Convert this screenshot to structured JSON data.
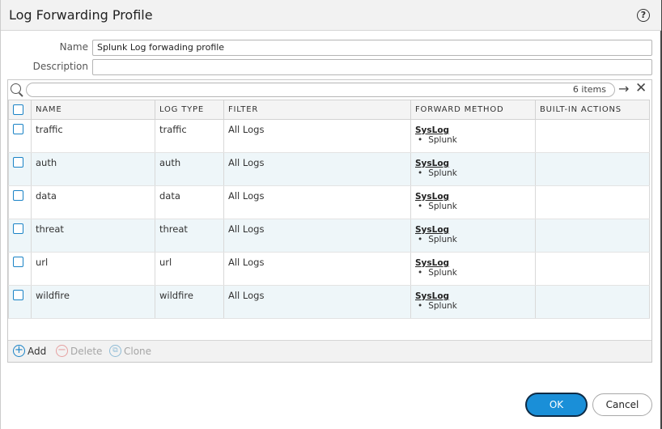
{
  "dialog": {
    "title": "Log Forwarding Profile",
    "help_icon": "?"
  },
  "form": {
    "name_label": "Name",
    "name_value": "Splunk Log forwading profile",
    "description_label": "Description",
    "description_value": ""
  },
  "search": {
    "placeholder": "",
    "item_count": "6 items",
    "apply_icon": "→",
    "clear_icon": "✕"
  },
  "table": {
    "columns": [
      "NAME",
      "LOG TYPE",
      "FILTER",
      "FORWARD METHOD",
      "BUILT-IN ACTIONS"
    ],
    "rows": [
      {
        "name": "traffic",
        "log_type": "traffic",
        "filter": "All Logs",
        "method": "SysLog",
        "target": "Splunk",
        "actions": ""
      },
      {
        "name": "auth",
        "log_type": "auth",
        "filter": "All Logs",
        "method": "SysLog",
        "target": "Splunk",
        "actions": ""
      },
      {
        "name": "data",
        "log_type": "data",
        "filter": "All Logs",
        "method": "SysLog",
        "target": "Splunk",
        "actions": ""
      },
      {
        "name": "threat",
        "log_type": "threat",
        "filter": "All Logs",
        "method": "SysLog",
        "target": "Splunk",
        "actions": ""
      },
      {
        "name": "url",
        "log_type": "url",
        "filter": "All Logs",
        "method": "SysLog",
        "target": "Splunk",
        "actions": ""
      },
      {
        "name": "wildfire",
        "log_type": "wildfire",
        "filter": "All Logs",
        "method": "SysLog",
        "target": "Splunk",
        "actions": ""
      }
    ]
  },
  "toolbar": {
    "add_label": "Add",
    "delete_label": "Delete",
    "clone_label": "Clone"
  },
  "footer": {
    "ok_label": "OK",
    "cancel_label": "Cancel"
  },
  "colors": {
    "accent": "#1a8fd8",
    "row_alt": "#eef6f9",
    "header_bg": "#f2f2f2"
  }
}
